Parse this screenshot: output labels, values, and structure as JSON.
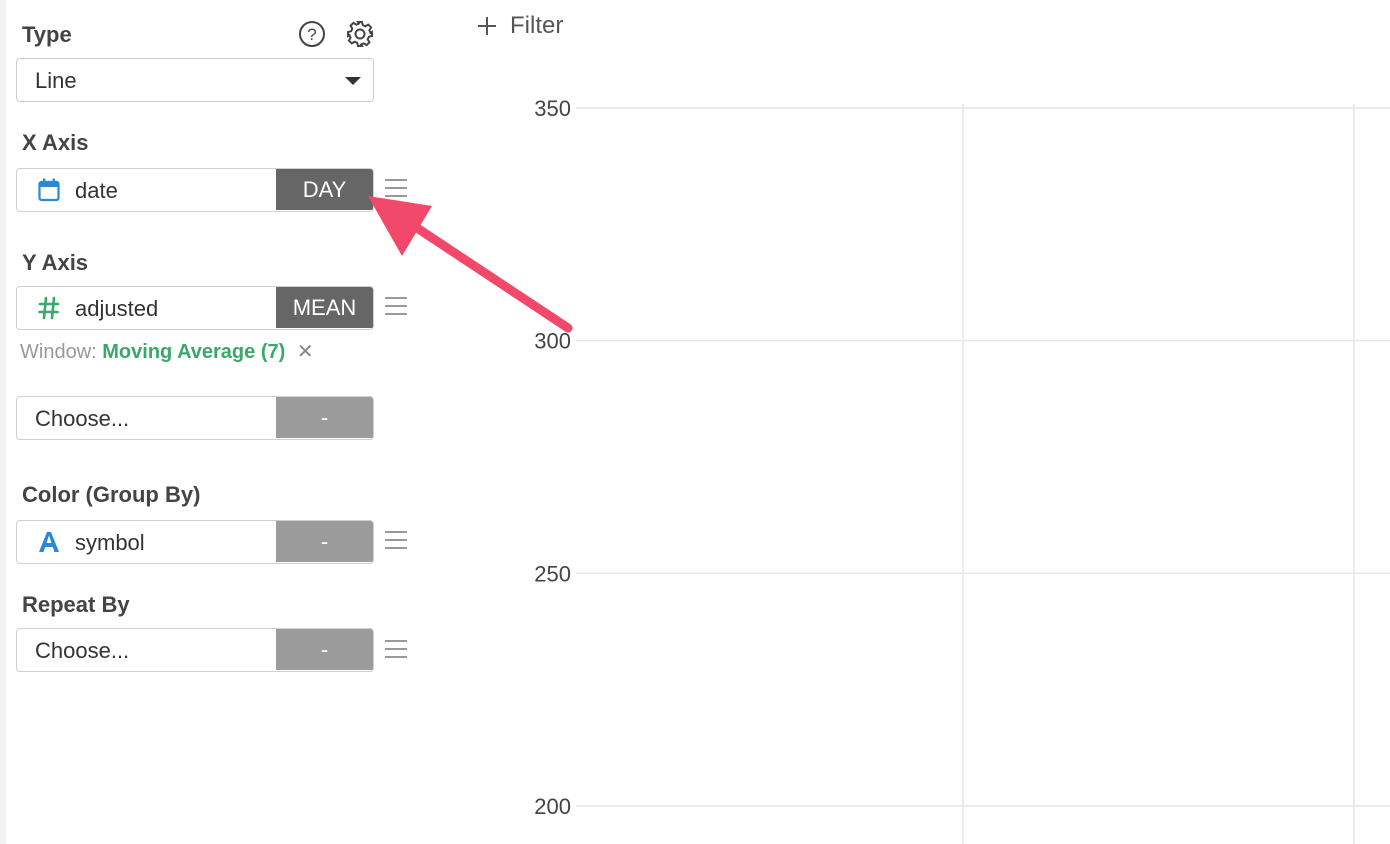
{
  "type_section": {
    "label": "Type",
    "selected": "Line",
    "help_icon": "question-circle-icon",
    "settings_icon": "gear-icon"
  },
  "x_axis": {
    "label": "X Axis",
    "field": "date",
    "field_icon": "calendar-icon",
    "aggregation": "DAY"
  },
  "y_axis": {
    "label": "Y Axis",
    "field": "adjusted",
    "field_icon": "hash-icon",
    "aggregation": "MEAN",
    "window_label": "Window:",
    "window_value": "Moving Average (7)",
    "window_close": "✕",
    "second_field": "Choose...",
    "second_aggregation": "-"
  },
  "color": {
    "label": "Color (Group By)",
    "field": "symbol",
    "field_icon": "text-a-icon",
    "aggregation": "-"
  },
  "repeat": {
    "label": "Repeat By",
    "field": "Choose...",
    "aggregation": "-"
  },
  "toolbar": {
    "filter_label": "Filter",
    "filter_icon": "plus-icon"
  },
  "colors": {
    "accent_green": "#3aa86b",
    "calendar_blue": "#2a88d8",
    "hash_green": "#3aa86b",
    "text_a_blue": "#2a88d8",
    "annotation_arrow": "#f2486a",
    "agg_dark": "#666666",
    "agg_light": "#9b9b9b"
  },
  "chart_data": {
    "type": "line",
    "title": "",
    "xlabel": "",
    "ylabel": "",
    "y_ticks": [
      350,
      300,
      250,
      200
    ],
    "ylim": [
      200,
      350
    ],
    "grid": true,
    "series": []
  }
}
